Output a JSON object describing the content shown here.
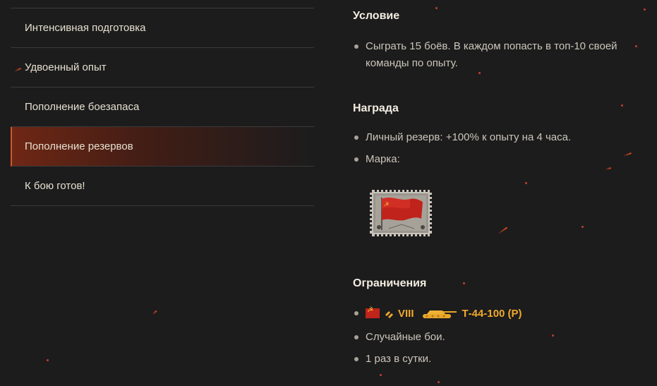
{
  "menu": {
    "items": [
      {
        "label": "Интенсивная подготовка",
        "active": false
      },
      {
        "label": "Удвоенный опыт",
        "active": false
      },
      {
        "label": "Пополнение боезапаса",
        "active": false
      },
      {
        "label": "Пополнение резервов",
        "active": true
      },
      {
        "label": "К бою готов!",
        "active": false
      }
    ]
  },
  "condition": {
    "title": "Условие",
    "items": [
      "Сыграть 15 боёв. В каждом попасть в топ-10 своей команды по опыту."
    ]
  },
  "reward": {
    "title": "Награда",
    "items": [
      "Личный резерв: +100% к опыту на 4 часа.",
      "Марка:"
    ]
  },
  "restrictions": {
    "title": "Ограничения",
    "vehicle": {
      "nation_icon": "ussr-flag-icon",
      "class_icon": "medium-tank-icon",
      "tier": "VIII",
      "name": "Т-44-100 (Р)"
    },
    "items": [
      "Случайные бои.",
      "1 раз в сутки."
    ]
  },
  "colors": {
    "background": "#1c1c1d",
    "accent": "#d8562e",
    "tier_gold": "#f0a92b"
  }
}
